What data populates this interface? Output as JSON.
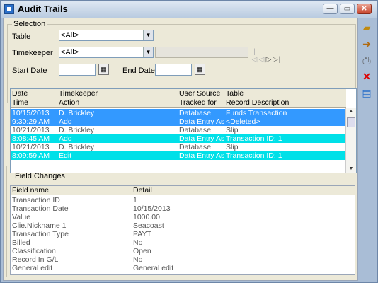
{
  "window": {
    "title": "Audit Trails",
    "controls": {
      "minimize": "—",
      "restore": "▭",
      "close": "✕"
    }
  },
  "selection": {
    "legend": "Selection",
    "table_label": "Table",
    "table_value": "<All>",
    "timekeeper_label": "Timekeeper",
    "timekeeper_value": "<All>",
    "start_date_label": "Start Date",
    "start_date_value": "",
    "end_date_label": "End Date",
    "end_date_value": ""
  },
  "grid": {
    "header_row1": [
      "Date",
      "Timekeeper",
      "User Source",
      "Table"
    ],
    "header_row2": [
      "Time",
      "Action",
      "Tracked for",
      "Record Description"
    ],
    "rows": [
      {
        "style": "selected",
        "cells": [
          "10/15/2013",
          "D. Brickley",
          "Database",
          "Funds Transaction"
        ]
      },
      {
        "style": "selected",
        "cells": [
          "9:30:29 AM",
          "Add",
          "Data Entry Assi",
          "<Deleted>"
        ]
      },
      {
        "style": "plain",
        "cells": [
          "10/21/2013",
          "D. Brickley",
          "Database",
          "Slip"
        ]
      },
      {
        "style": "cyan",
        "cells": [
          "8:08:45 AM",
          "Add",
          "Data Entry Assi",
          "Transaction ID: 1"
        ]
      },
      {
        "style": "plain",
        "cells": [
          "10/21/2013",
          "D. Brickley",
          "Database",
          "Slip"
        ]
      },
      {
        "style": "cyan",
        "cells": [
          "8:09:59 AM",
          "Edit",
          "Data Entry Assi",
          "Transaction ID: 1"
        ]
      }
    ]
  },
  "field_changes": {
    "title": "Field Changes",
    "header": [
      "Field name",
      "Detail"
    ],
    "rows": [
      [
        "Transaction ID",
        "1"
      ],
      [
        "Transaction Date",
        "10/15/2013"
      ],
      [
        "Value",
        "1000.00"
      ],
      [
        "Clie.Nickname 1",
        "Seacoast"
      ],
      [
        "Transaction Type",
        "PAYT"
      ],
      [
        "Billed",
        "No"
      ],
      [
        "Classification",
        "Open"
      ],
      [
        "Record In G/L",
        "No"
      ],
      [
        "General edit",
        "General edit"
      ]
    ]
  },
  "icons": {
    "calendar": "▦",
    "dropdown": "▼",
    "toolbar": [
      "folder-open-icon",
      "export-icon",
      "print-icon",
      "delete-icon",
      "report-icon"
    ]
  }
}
